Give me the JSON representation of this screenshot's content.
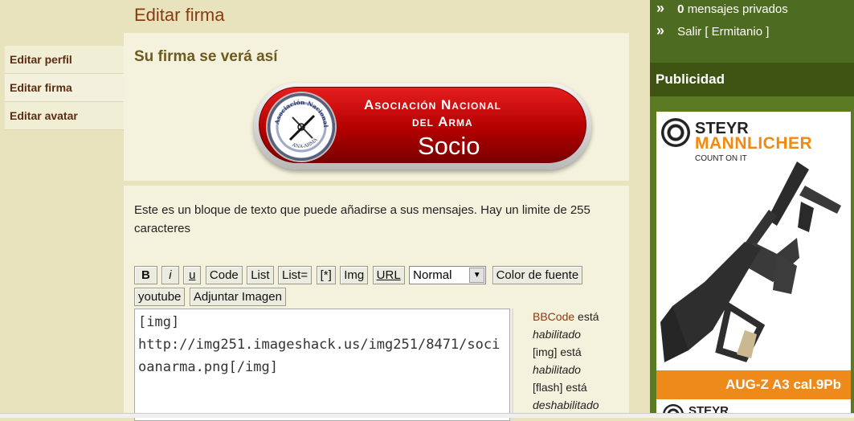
{
  "page": {
    "title": "Editar firma"
  },
  "leftnav": {
    "items": [
      {
        "label": "Editar perfil"
      },
      {
        "label": "Editar firma"
      },
      {
        "label": "Editar avatar"
      }
    ]
  },
  "preview": {
    "title": "Su firma se verá así",
    "badge": {
      "line1": "Asociación Nacional",
      "line2": "del Arma",
      "line3": "Socio",
      "seal_text": "Asociación Nacional del Arma",
      "seal_bottom": "ANA-ARMA"
    }
  },
  "form": {
    "description": "Este es un bloque de texto que puede añadirse a sus mensajes. Hay un limite de 255 caracteres",
    "toolbar": {
      "bold": "B",
      "italic": "i",
      "underline": "u",
      "code": "Code",
      "list": "List",
      "list_eq": "List=",
      "list_item": "[*]",
      "img": "Img",
      "url": "URL",
      "size_select": "Normal",
      "color": "Color de fuente",
      "youtube": "youtube",
      "attach": "Adjuntar Imagen"
    },
    "signature_text": "[img]\nhttp://img251.imageshack.us/img251/8471/socioanarma.png[/img]",
    "bbinfo": {
      "bbcode_link": "BBCode",
      "esta1": " está",
      "habilitado1": "habilitado",
      "img_label": "[img] está",
      "habilitado2": "habilitado",
      "flash_label": "[flash] está",
      "deshabilitado": "deshabilitado"
    }
  },
  "sidebar": {
    "pm_count": "0",
    "pm_label": "mensajes privados",
    "logout": "Salir [ Ermitanio ]",
    "ads_heading": "Publicidad",
    "ad": {
      "brand1": "STEYR",
      "brand2": "MANNLICHER",
      "tagline": "COUNT ON IT",
      "model": "AUG-Z A3 cal.9Pb",
      "brand_bottom": "STEYR"
    }
  },
  "colors": {
    "accent_brown": "#8b3a10",
    "sidebar_green": "#4d6b21",
    "sidebar_dark_green": "#3f5412",
    "badge_red": "#c40000",
    "ad_orange": "#ee8a1a"
  }
}
